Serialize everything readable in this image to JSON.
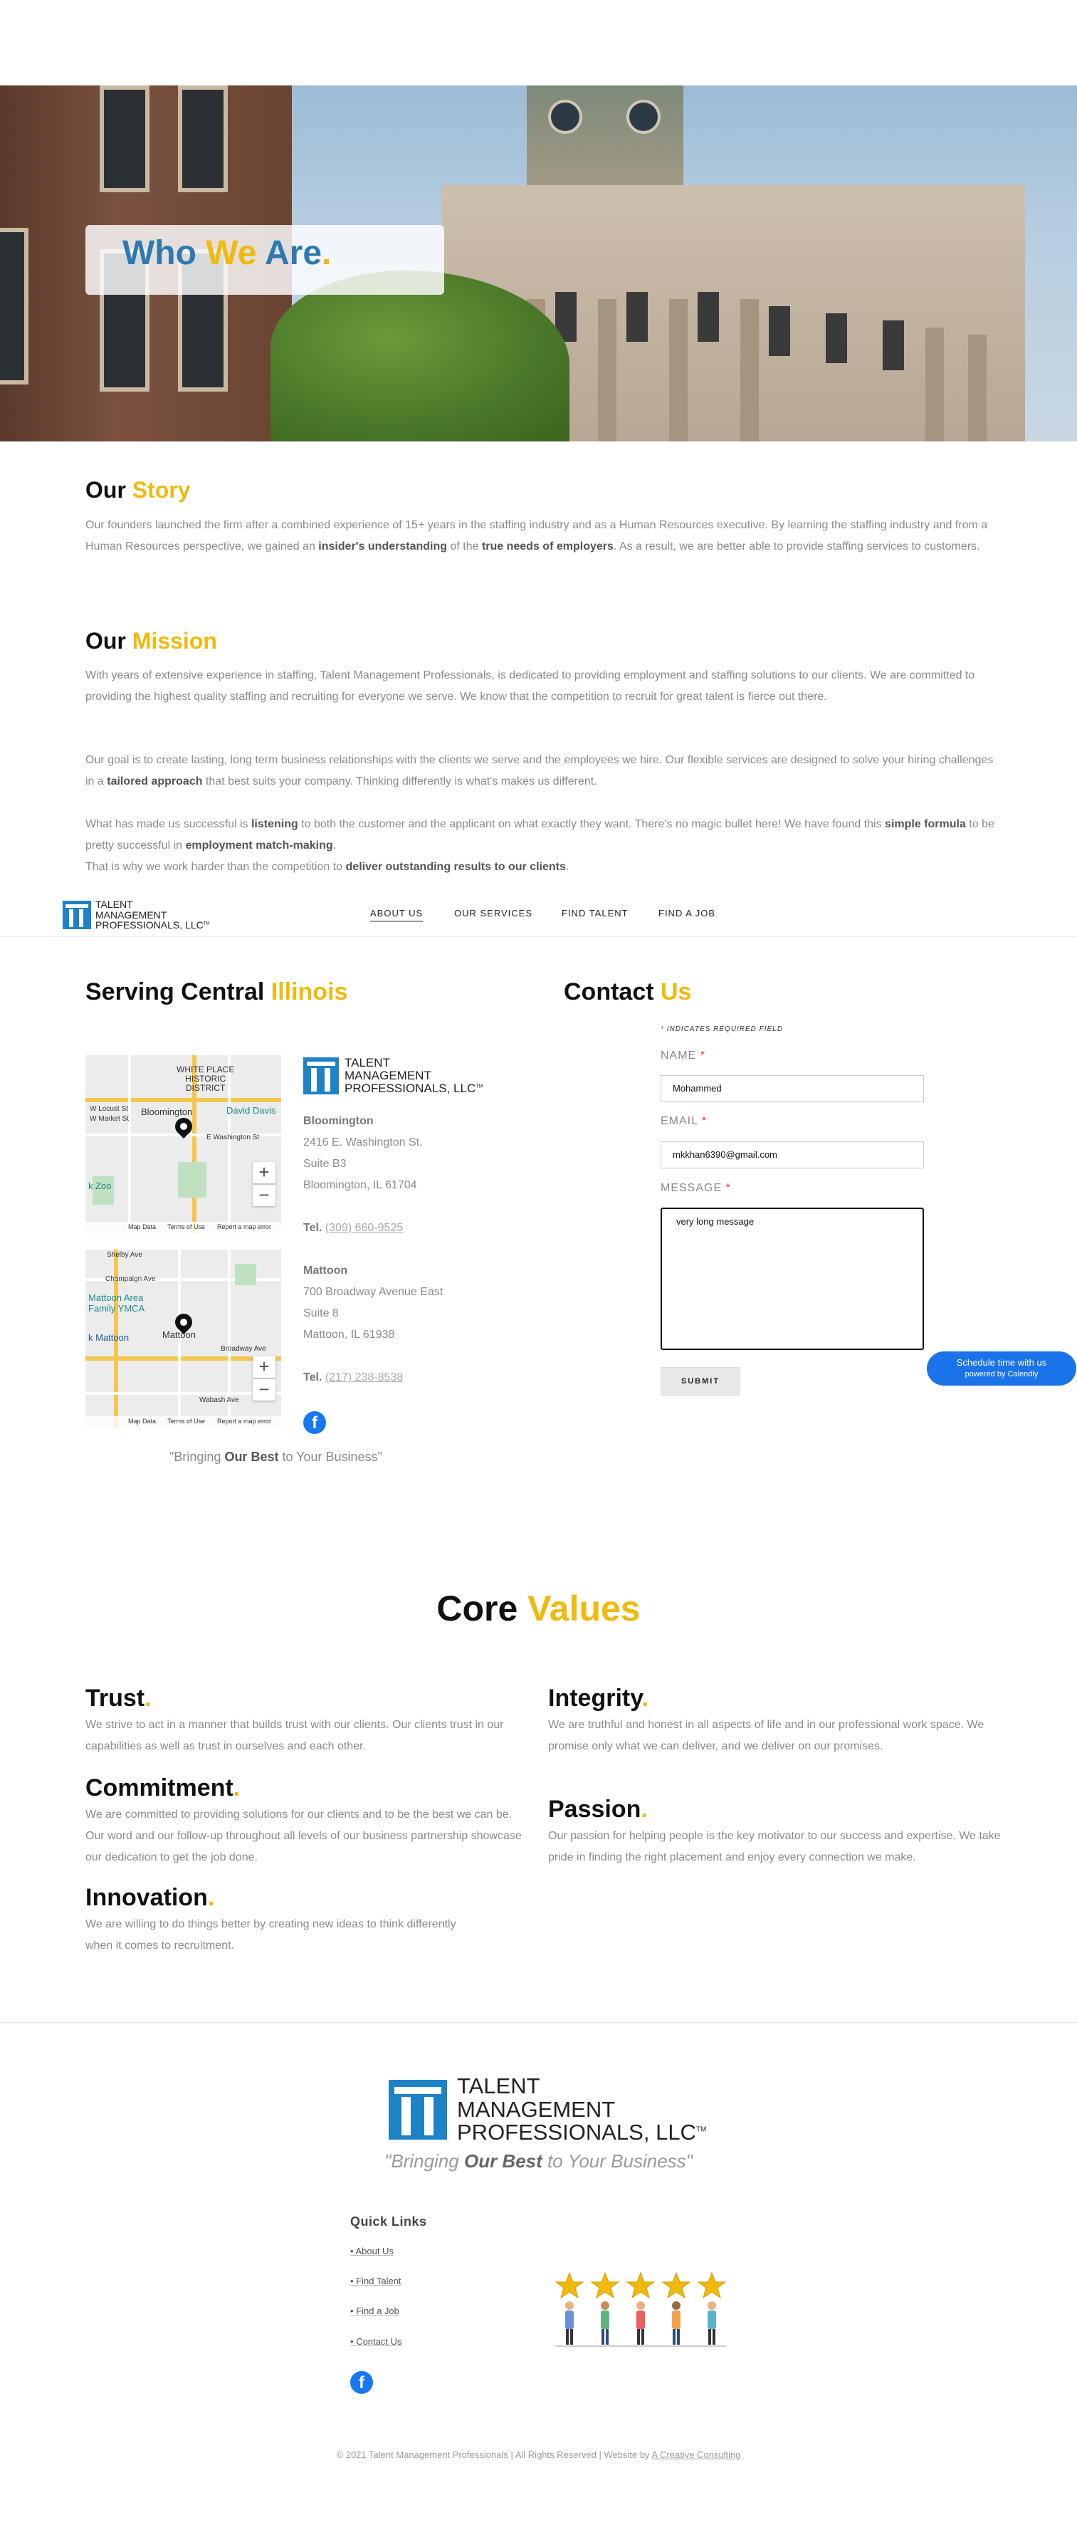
{
  "hero": {
    "title_part1": "Who ",
    "title_part2": "We",
    "title_part3": " Are",
    "title_dot": "."
  },
  "story": {
    "heading_plain": "Our ",
    "heading_accent": "Story",
    "text_1": "Our founders launched the firm after a combined experience of 15+ years in the staffing industry and as a Human Resources executive. By learning the staffing industry and from a Human Resources perspective, we gained an ",
    "bold_1": "insider's understanding",
    "text_2": " of the ",
    "bold_2": "true needs of employers",
    "text_3": ". As a result, we are better able to provide staffing services to customers."
  },
  "mission": {
    "heading_plain": "Our ",
    "heading_accent": "Mission",
    "p1": "With years of extensive experience in staffing, Talent Management Professionals, is dedicated to providing employment and staffing solutions to our clients. We are committed to providing the highest quality staffing and recruiting for everyone we serve. We know that the competition to recruit for great talent is fierce out there.",
    "p2_a": "Our goal is to create lasting, long term business relationships with the clients we serve and the employees we hire.  Our flexible services are designed to solve your hiring challenges in a ",
    "p2_bold": "tailored approach",
    "p2_b": " that best suits your company. Thinking differently is what's makes us different.",
    "p3_a": "What has made us successful is ",
    "p3_bold1": "listening",
    "p3_b": " to both the customer and the applicant on what exactly they want. There's no magic bullet here! We have found this ",
    "p3_bold2": "simple formula",
    "p3_c": " to be pretty successful in ",
    "p3_bold3": "employment match-making",
    "p3_d": ".",
    "p3_e": "That is why we work harder than the competition to ",
    "p3_bold4": "deliver outstanding results to our clients",
    "p3_f": "."
  },
  "brand": {
    "line1": "TALENT",
    "line2": "MANAGEMENT",
    "line3": "PROFESSIONALS, LLC",
    "tm": "TM"
  },
  "nav": {
    "items": [
      "ABOUT US",
      "OUR SERVICES",
      "FIND TALENT",
      "FIND A JOB"
    ]
  },
  "serving": {
    "heading_plain": "Serving Central ",
    "heading_accent": "Illinois",
    "map1": {
      "label1": "WHITE PLACE",
      "label2": "HISTORIC",
      "label3": "DISTRICT",
      "city": "Bloomington",
      "poi": "David Davis",
      "street1": "W Locust St",
      "street2": "W Market St",
      "street3": "E Washington St",
      "zoo": "k Zoo",
      "footer_data": "Map Data",
      "footer_terms": "Terms of Use",
      "footer_report": "Report a map error"
    },
    "map2": {
      "city": "Mattoon",
      "poi": "Mattoon Area Family YMCA",
      "street1": "Shelby Ave",
      "street2": "Champaign Ave",
      "street3": "Broadway Ave",
      "street4": "Wabash Ave",
      "poi2": "k Mattoon",
      "footer_data": "Map Data",
      "footer_terms": "Terms of Use",
      "footer_report": "Report a map error"
    },
    "loc1": {
      "city": "Bloomington",
      "address1": "2416 E. Washington St.",
      "address2": "Suite B3",
      "address3": "Bloomington, IL 61704",
      "tel_label": "Tel.",
      "tel": "(309) 660-9525"
    },
    "loc2": {
      "city": "Mattoon",
      "address1": "700 Broadway Avenue East",
      "address2": "Suite 8",
      "address3": "Mattoon, IL 61938",
      "tel_label": "Tel.",
      "tel": "(217) 238-8538"
    },
    "tagline_a": "\"Bringing ",
    "tagline_bold": "Our Best",
    "tagline_b": " to Your Business\""
  },
  "contact": {
    "heading_plain": "Contact ",
    "heading_accent": "Us",
    "required_note": "INDICATES REQUIRED FIELD",
    "name_label": "NAME",
    "name_value": "Mohammed",
    "email_label": "EMAIL",
    "email_value": "mkkhan6390@gmail.com",
    "message_label": "MESSAGE",
    "message_value": "very long message",
    "submit_label": "SUBMIT",
    "star": "*"
  },
  "calendly": {
    "line1": "Schedule time with us",
    "line2": "powered by Calendly"
  },
  "core_values": {
    "heading_plain": "Core ",
    "heading_accent": "Values",
    "items": [
      {
        "title": "Trust",
        "text": "We strive to act in a manner that builds trust with our clients. Our clients trust in our capabilities as well as trust in ourselves and each other."
      },
      {
        "title": "Commitment",
        "text": "We are committed to providing solutions for our clients and to be the best we can be. Our word and our follow-up throughout all levels of our business partnership showcase our dedication to get the job done."
      },
      {
        "title": "Innovation",
        "text": "We are willing to do things better by creating new ideas to think differently when it comes to recruitment."
      },
      {
        "title": "Integrity",
        "text": "We are truthful and honest in all aspects of life and in our professional work space. We promise only what we can deliver, and we deliver on our promises."
      },
      {
        "title": "Passion",
        "text": "Our passion for helping people is the key motivator to our success and expertise. We take pride in finding the right placement and enjoy every connection we make."
      }
    ],
    "dot": "."
  },
  "footer": {
    "tagline_a": "\"Bringing ",
    "tagline_bold": "Our Best",
    "tagline_b": " to Your Business\"",
    "quick_links_heading": "Quick Links",
    "quick_links": [
      "About Us",
      "Find Talent",
      "Find a Job",
      "Contact Us"
    ],
    "bullet": "•",
    "copyright_text": "© 2021 Talent Management Professionals | All Rights Reserved | Website by ",
    "copyright_link": "A Creative Consulting"
  },
  "colors": {
    "accent": "#f0b90e",
    "brand_blue": "#1e82c6",
    "hero_blue": "#2e7ab0",
    "calendly_blue": "#1a73e8",
    "facebook": "#1877f2"
  },
  "icons": {
    "facebook": "facebook-icon",
    "map_pin": "map-pin-icon",
    "zoom_in": "zoom-in-icon",
    "zoom_out": "zoom-out-icon"
  }
}
